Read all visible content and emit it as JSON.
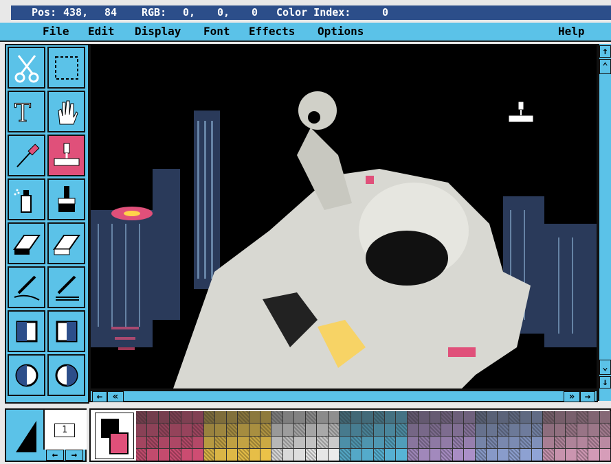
{
  "status": {
    "pos_label": "Pos:",
    "pos_x": "438,",
    "pos_y": "84",
    "rgb_label": "RGB:",
    "r": "0,",
    "g": "0,",
    "b": "0",
    "color_index_label": "Color Index:",
    "color_index": "0"
  },
  "menu": {
    "file": "File",
    "edit": "Edit",
    "display": "Display",
    "font": "Font",
    "effects": "Effects",
    "options": "Options",
    "help": "Help"
  },
  "tools": [
    {
      "name": "scissors-icon"
    },
    {
      "name": "marquee-select-icon"
    },
    {
      "name": "text-tool-icon"
    },
    {
      "name": "hand-pan-icon"
    },
    {
      "name": "eyedropper-icon"
    },
    {
      "name": "paint-roller-icon",
      "selected": true
    },
    {
      "name": "spray-can-icon"
    },
    {
      "name": "paint-brush-icon"
    },
    {
      "name": "eraser-icon"
    },
    {
      "name": "color-eraser-icon"
    },
    {
      "name": "pen-curve-icon"
    },
    {
      "name": "pen-line-icon"
    },
    {
      "name": "filled-rect-icon"
    },
    {
      "name": "hollow-rect-icon"
    },
    {
      "name": "filled-ellipse-icon"
    },
    {
      "name": "hollow-ellipse-icon"
    }
  ],
  "line_width": "1",
  "colors": {
    "accent": "#5bc2e8",
    "status_bar": "#2c4e8a",
    "selected_tool": "#e0507a"
  }
}
